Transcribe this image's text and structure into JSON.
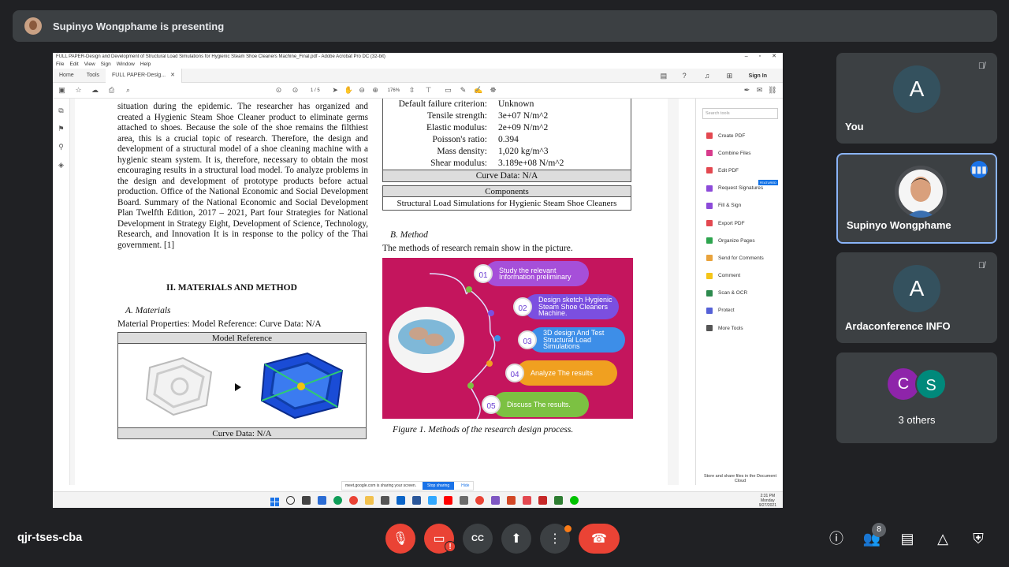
{
  "meet": {
    "presenting_text": "Supinyo Wongphame is presenting",
    "meeting_code": "qjr-tses-cba",
    "participants_count": "8",
    "colors": {
      "bg": "#202124",
      "tile": "#3c4043",
      "danger": "#ea4335",
      "accent": "#8ab4f8"
    }
  },
  "participants": [
    {
      "initial": "A",
      "name": "You",
      "color": "#34515e"
    },
    {
      "initial": "",
      "name": "Supinyo Wongphame",
      "color": "#4a4d51"
    },
    {
      "initial": "A",
      "name": "Ardaconference INFO",
      "color": "#34515e"
    },
    {
      "initials": [
        "C",
        "S"
      ],
      "name": "3 others"
    }
  ],
  "acrobat": {
    "window_title": "FULL PAPER-Design and Development of Structural Load Simulations for Hygienic Steam Shoe Cleaners Machine_Final.pdf - Adobe Acrobat Pro DC (32-bit)",
    "menu": [
      "File",
      "Edit",
      "View",
      "Sign",
      "Window",
      "Help"
    ],
    "tabs": [
      "Home",
      "Tools",
      "FULL PAPER-Desig..."
    ],
    "sign_in": "Sign In",
    "page_indicator": "1 / 5",
    "zoom": "176%",
    "search_placeholder": "Search tools",
    "tools": [
      "Create PDF",
      "Combine Files",
      "Edit PDF",
      "Request Signatures",
      "Fill & Sign",
      "Export PDF",
      "Organize Pages",
      "Send for Comments",
      "Comment",
      "Scan & OCR",
      "Protect",
      "More Tools"
    ],
    "tool_colors": [
      "#e34850",
      "#d83b8c",
      "#e34850",
      "#8c4ad9",
      "#8c4ad9",
      "#e34850",
      "#2da44e",
      "#e9a33c",
      "#f5c518",
      "#2d8a4e",
      "#5561d7",
      "#555555"
    ],
    "featured": "FEATURED",
    "store_text": "Store and share files in the Document Cloud"
  },
  "paper": {
    "left_paragraph": "situation during the epidemic. The researcher has organized and created a Hygienic Steam Shoe Cleaner product to eliminate germs attached to shoes. Because the sole of the shoe remains the filthiest area, this is a crucial topic of research. Therefore, the design and development of a structural model of a shoe cleaning machine with a hygienic steam system. It is, therefore, necessary to obtain the most encouraging results in a structural load model. To analyze problems in the design and development of prototype products before actual production. Office of the National Economic and Social Development Board. Summary of the National Economic and Social Development Plan Twelfth Edition, 2017 – 2021, Part four Strategies for National Development in Strategy Eight, Development of Science, Technology, Research, and Innovation It is in response to the policy of the Thai government. [1]",
    "section_heading": "II.   MATERIALS AND METHOD",
    "materials_heading": "A.   Materials",
    "material_props": "Material Properties: Model Reference: Curve Data: N/A",
    "model_reference": "Model Reference",
    "curve_data_left": "Curve Data: N/A",
    "props": [
      {
        "k": "Default failure criterion:",
        "v": "Unknown"
      },
      {
        "k": "Tensile strength:",
        "v": "3e+07 N/m^2"
      },
      {
        "k": "Elastic modulus:",
        "v": "2e+09 N/m^2"
      },
      {
        "k": "Poisson's ratio:",
        "v": "0.394"
      },
      {
        "k": "Mass density:",
        "v": "1,020 kg/m^3"
      },
      {
        "k": "Shear modulus:",
        "v": "3.189e+08 N/m^2"
      }
    ],
    "curve_data_right": "Curve Data: N/A",
    "components": "Components",
    "components_value": "Structural Load Simulations for Hygienic Steam Shoe Cleaners",
    "method_heading": "B.   Method",
    "method_text": "The methods of research remain show in the picture.",
    "figure_caption": "Figure 1. Methods of the research design process.",
    "steps": [
      {
        "num": "01",
        "text": "Study the relevant Information preliminary",
        "color": "#a64fd9"
      },
      {
        "num": "02",
        "text": "Design sketch Hygienic Steam Shoe Cleaners Machine.",
        "color": "#7b4fe0"
      },
      {
        "num": "03",
        "text": "3D design And Test Structural Load Simulations",
        "color": "#3d8ee8"
      },
      {
        "num": "04",
        "text": "Analyze The results",
        "color": "#f0a020"
      },
      {
        "num": "05",
        "text": "Discuss The results.",
        "color": "#7cc142"
      }
    ],
    "step_label": "STEP"
  },
  "share_bar": {
    "text": "meet.google.com is sharing your screen.",
    "stop": "Stop sharing",
    "hide": "Hide"
  },
  "clock": {
    "time": "2:31 PM",
    "day": "Monday",
    "date": "9/27/2021"
  }
}
